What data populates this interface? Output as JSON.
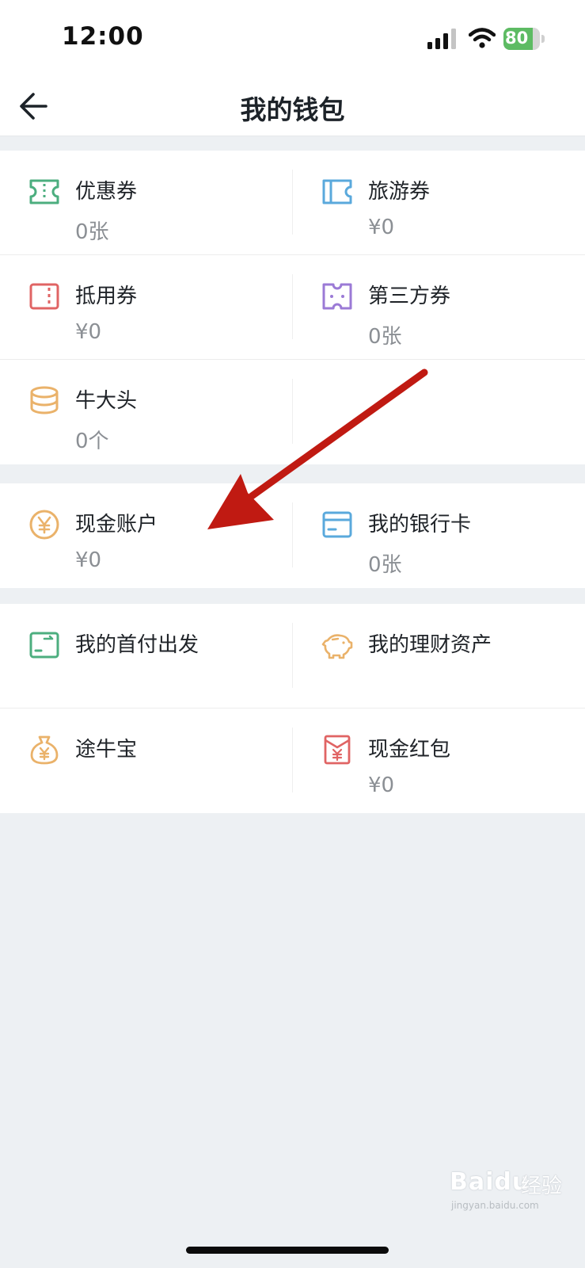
{
  "status_bar": {
    "time": "12:00",
    "battery_percent": 80,
    "battery_label": "80"
  },
  "nav": {
    "title": "我的钱包"
  },
  "sections": [
    {
      "rows": [
        [
          {
            "label": "优惠券",
            "value": "0张"
          },
          {
            "label": "旅游券",
            "value": "¥0"
          }
        ],
        [
          {
            "label": "抵用券",
            "value": "¥0"
          },
          {
            "label": "第三方券",
            "value": "0张"
          }
        ],
        [
          {
            "label": "牛大头",
            "value": "0个"
          }
        ]
      ]
    },
    {
      "rows": [
        [
          {
            "label": "现金账户",
            "value": "¥0"
          },
          {
            "label": "我的银行卡",
            "value": "0张"
          }
        ]
      ]
    },
    {
      "rows": [
        [
          {
            "label": "我的首付出发"
          },
          {
            "label": "我的理财资产"
          }
        ],
        [
          {
            "label": "途牛宝"
          },
          {
            "label": "现金红包",
            "value": "¥0"
          }
        ]
      ]
    }
  ],
  "icons": {
    "coupon": "ticket-icon",
    "travel": "travel-voucher-icon",
    "deduction": "voucher-icon",
    "third_party": "third-party-voucher-icon",
    "niu_coins": "coin-stack-icon",
    "cash_account": "yuan-circle-icon",
    "bank_card": "bank-card-icon",
    "down_payment": "down-payment-card-icon",
    "wealth": "piggy-bank-icon",
    "tuniubao": "money-bag-icon",
    "red_packet": "red-envelope-icon"
  },
  "colors": {
    "green": "#4cae7f",
    "blue": "#5aa9dc",
    "red": "#e06464",
    "purple": "#9b7ad6",
    "orange": "#eab26a",
    "annotation_arrow": "#c01a12"
  },
  "watermark": {
    "brand": "Baidu",
    "text": "经验",
    "url": "jingyan.baidu.com"
  }
}
